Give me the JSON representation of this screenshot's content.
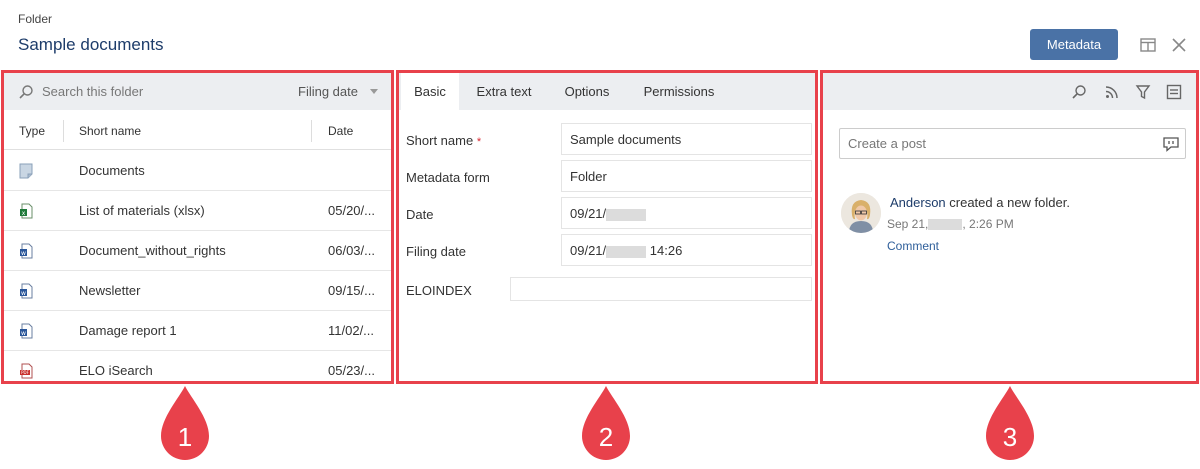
{
  "header": {
    "breadcrumb": "Folder",
    "title": "Sample documents",
    "metadata_button": "Metadata",
    "icons": [
      "layout-icon",
      "close-icon"
    ]
  },
  "panel1": {
    "search_placeholder": "Search this folder",
    "sort_label": "Filing date",
    "columns": [
      "Type",
      "Short name",
      "Date"
    ],
    "rows": [
      {
        "icon": "folder-icon",
        "name": "Documents",
        "date": ""
      },
      {
        "icon": "excel-file-icon",
        "name": "List of materials (xlsx)",
        "date": "05/20/..."
      },
      {
        "icon": "word-file-icon",
        "name": "Document_without_rights",
        "date": "06/03/..."
      },
      {
        "icon": "word-file-icon",
        "name": "Newsletter",
        "date": "09/15/..."
      },
      {
        "icon": "word-file-icon",
        "name": "Damage report 1",
        "date": "11/02/..."
      },
      {
        "icon": "pdf-file-icon",
        "name": "ELO iSearch",
        "date": "05/23/..."
      }
    ]
  },
  "panel2": {
    "tabs": [
      "Basic",
      "Extra text",
      "Options",
      "Permissions"
    ],
    "active_tab": "Basic",
    "fields": [
      {
        "label": "Short name",
        "required_mark": "*",
        "value": "Sample documents"
      },
      {
        "label": "Metadata form",
        "value": "Folder"
      },
      {
        "label": "Date",
        "value_prefix": "09/21/",
        "value_suffix": ""
      },
      {
        "label": "Filing date",
        "value_prefix": "09/21/",
        "value_suffix": " 14:26"
      },
      {
        "label": "ELOINDEX",
        "value": ""
      }
    ]
  },
  "panel3": {
    "toolbar_icons": [
      "search-icon",
      "rss-icon",
      "filter-icon",
      "list-icon"
    ],
    "post_placeholder": "Create a post",
    "feed": {
      "user": "Anderson",
      "action": " created a new folder.",
      "time_prefix": "Sep 21,",
      "time_suffix": ", 2:26 PM",
      "comment_label": "Comment"
    }
  },
  "markers": [
    "1",
    "2",
    "3"
  ],
  "colors": {
    "accent": "#4a72a6",
    "highlight": "#e8414b",
    "title": "#1d3c6a"
  }
}
